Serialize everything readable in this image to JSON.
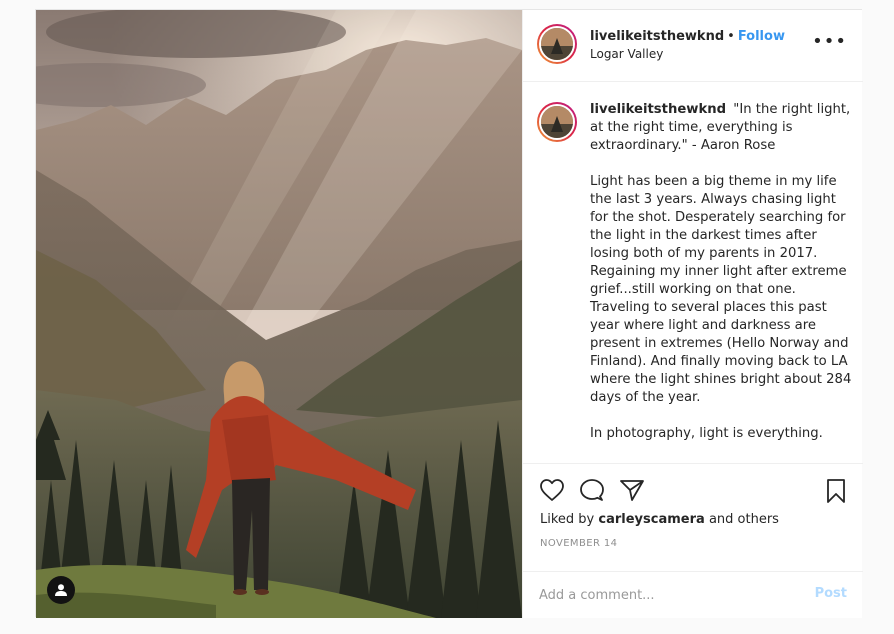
{
  "post": {
    "username": "livelikeitsthewknd",
    "follow_label": "Follow",
    "dot": "•",
    "location": "Logar Valley",
    "more_label": "•••",
    "caption_paragraphs": [
      "\"In the right light, at the right time, everything is extraordinary.\" - Aaron Rose",
      "Light has been a big theme in my life the last 3 years. Always chasing light for the shot. Desperately searching for the light in the darkest times after losing both of my parents in 2017. Regaining my inner light after extreme grief...still working on that one. Traveling to several places this past year where light and darkness are present in extremes (Hello Norway and Finland). And finally moving back to LA where the light shines bright about 284 days of the year.",
      "In photography, light is everything."
    ],
    "likes_prefix": "Liked by",
    "likes_user": "carleyscamera",
    "likes_suffix": "and others",
    "date": "NOVEMBER 14",
    "comment_placeholder": "Add a comment...",
    "post_label": "Post"
  },
  "icons": [
    "heart-icon",
    "comment-icon",
    "share-icon",
    "bookmark-icon",
    "user-tag-icon"
  ],
  "colors": {
    "follow": "#3897f0",
    "post_disabled": "#b3dbff",
    "secondary_text": "#8e8e8e"
  }
}
